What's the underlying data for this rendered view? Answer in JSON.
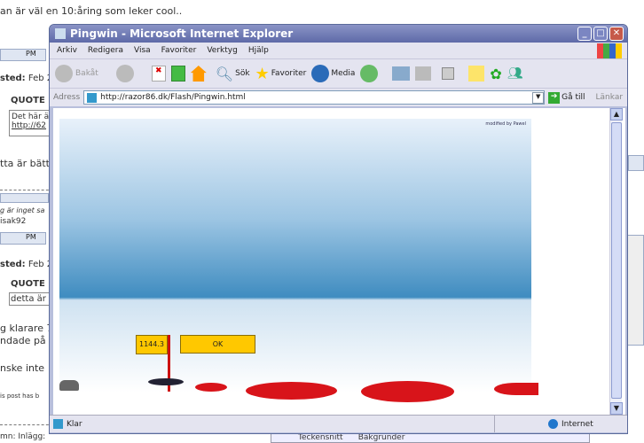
{
  "background": {
    "top_text": "an är väl en 10:åring som leker cool..",
    "pm_label": "PM",
    "posted_label": "sted:",
    "posted_date": "Feb 2",
    "quote_label": "QUOTE (",
    "quote1_text": "Det här ä",
    "quote1_link": "http://62",
    "text1": "tta är bätt",
    "sig1": "g är inget sa",
    "user": "isak92",
    "quote2_text": "detta är",
    "text2": "g klarare 7",
    "text3": "ndade på s",
    "text4": "nske inte",
    "edited": "is post has b",
    "bottom": "mn: Inlägg:",
    "bottom_bar": "Teckensnitt",
    "bottom_bar2": "Bakgrunder"
  },
  "window": {
    "title": "Pingwin - Microsoft Internet Explorer",
    "menu": [
      "Arkiv",
      "Redigera",
      "Visa",
      "Favoriter",
      "Verktyg",
      "Hjälp"
    ],
    "toolbar": {
      "back": "Bakåt",
      "search": "Sök",
      "favorites": "Favoriter",
      "media": "Media"
    },
    "address_label": "Adress",
    "url": "http://razor86.dk/Flash/Pingwin.html",
    "go": "Gå till",
    "links": "Länkar"
  },
  "game": {
    "credit": "modified by Pawel",
    "distance": "1144.3",
    "ok": "OK"
  },
  "status": {
    "text": "Klar",
    "zone": "Internet"
  }
}
